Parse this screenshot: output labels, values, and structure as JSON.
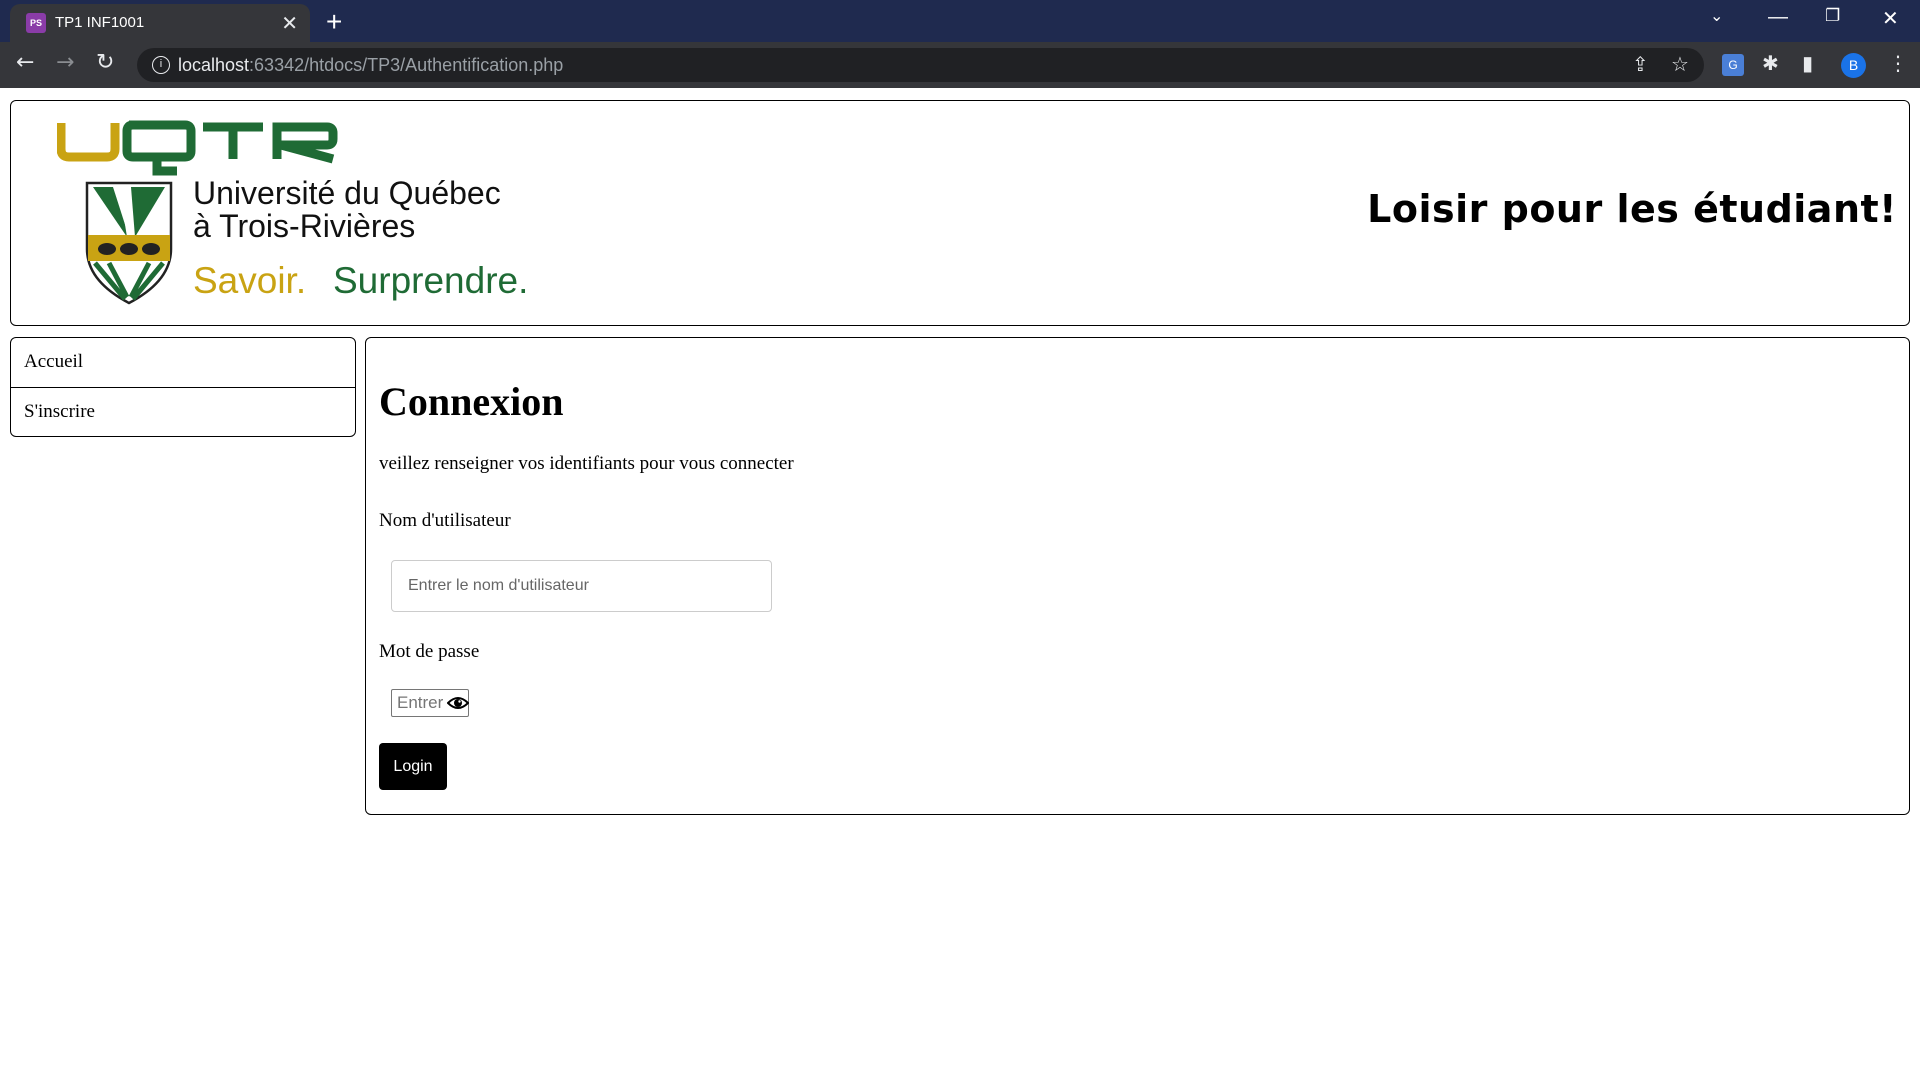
{
  "browser": {
    "tab_title": "TP1 INF1001",
    "tab_favicon_text": "PS",
    "url_host": "localhost",
    "url_rest": ":63342/htdocs/TP3/Authentification.php",
    "profile_initial": "B"
  },
  "header": {
    "logo_acronym": "UQTR",
    "logo_line1": "Université du Québec",
    "logo_line2": "à Trois-Rivières",
    "logo_slogan_1": "Savoir.",
    "logo_slogan_2": "Surprendre.",
    "site_title": "Loisir pour les étudiant!"
  },
  "sidebar": {
    "items": [
      {
        "label": "Accueil"
      },
      {
        "label": "S'inscrire"
      }
    ]
  },
  "login": {
    "heading": "Connexion",
    "intro": "veillez renseigner vos identifiants pour vous connecter",
    "username_label": "Nom d'utilisateur",
    "username_placeholder": "Entrer le nom d'utilisateur",
    "password_label": "Mot de passe",
    "password_placeholder": "Entrer le mot de passe",
    "submit_label": "Login"
  },
  "colors": {
    "tab_bar": "#1f2a4f",
    "toolbar": "#35363a",
    "uqtr_gold": "#c9a313",
    "uqtr_green": "#1f6b35"
  }
}
